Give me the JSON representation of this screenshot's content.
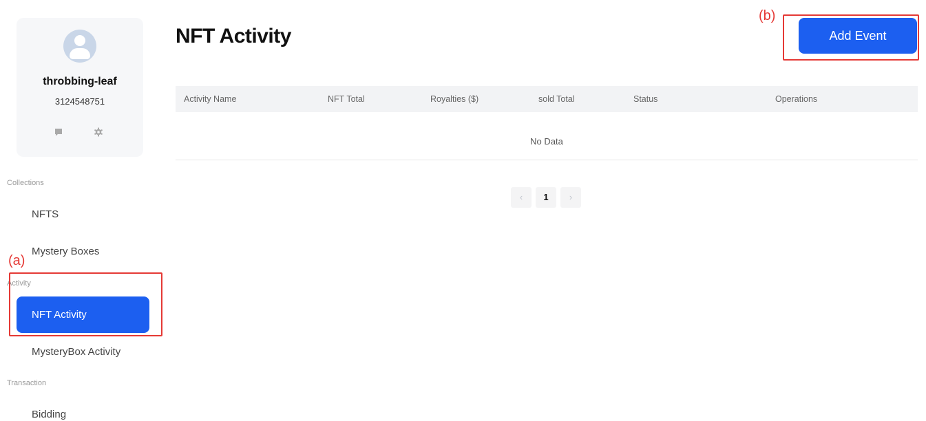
{
  "user": {
    "name": "throbbing-leaf",
    "id": "3124548751"
  },
  "sidebar": {
    "sections": {
      "collections": "Collections",
      "activity": "Activity",
      "transaction": "Transaction"
    },
    "items": {
      "nfts": "NFTS",
      "mystery_boxes": "Mystery Boxes",
      "nft_activity": "NFT Activity",
      "mysterybox_activity": "MysteryBox Activity",
      "bidding": "Bidding"
    },
    "active": "nft_activity"
  },
  "annotations": {
    "a": "(a)",
    "b": "(b)"
  },
  "main": {
    "title": "NFT Activity",
    "add_button": "Add Event",
    "table": {
      "columns": [
        "Activity Name",
        "NFT Total",
        "Royalties ($)",
        "sold Total",
        "Status",
        "Operations"
      ],
      "empty_text": "No Data"
    },
    "pagination": {
      "prev": "‹",
      "current": "1",
      "next": "›"
    }
  },
  "colors": {
    "accent": "#1c5ff0",
    "annotation": "#e53935"
  }
}
